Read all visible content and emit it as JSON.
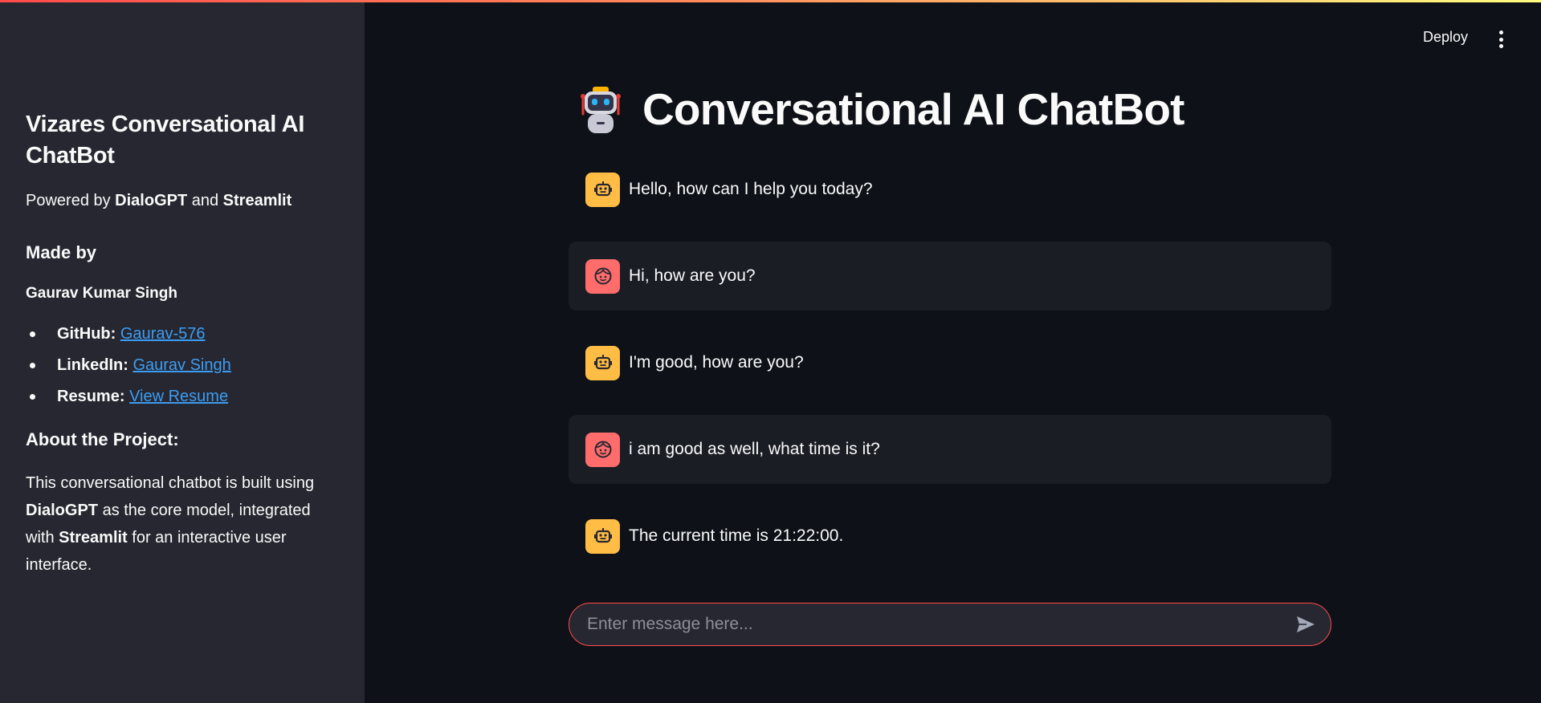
{
  "colors": {
    "bg": "#0e1117",
    "sidebar_bg": "#262730",
    "bot_avatar": "#ffbd45",
    "user_avatar": "#ff6c6c",
    "link": "#3d9df3",
    "accent": "#ff4b4b"
  },
  "sidebar": {
    "title": "Vizares Conversational AI ChatBot",
    "powered_prefix": "Powered by ",
    "powered_model": "DialoGPT",
    "powered_and": " and ",
    "powered_framework": "Streamlit",
    "made_by_heading": "Made by",
    "author": "Gaurav Kumar Singh",
    "links": [
      {
        "label": "GitHub:",
        "text": "Gaurav-576"
      },
      {
        "label": "LinkedIn:",
        "text": "Gaurav Singh"
      },
      {
        "label": "Resume:",
        "text": "View Resume"
      }
    ],
    "about_heading": "About the Project:",
    "about": {
      "p1": "This conversational chatbot is built using ",
      "b1": "DialoGPT",
      "p2": " as the core model, integrated with ",
      "b2": "Streamlit",
      "p3": " for an interactive user interface."
    }
  },
  "header": {
    "deploy_label": "Deploy",
    "menu_icon": "kebab-menu-icon"
  },
  "main": {
    "title": "Conversational AI ChatBot",
    "title_icon": "robot-emoji",
    "messages": [
      {
        "role": "assistant",
        "text": "Hello, how can I help you today?"
      },
      {
        "role": "user",
        "text": "Hi, how are you?"
      },
      {
        "role": "assistant",
        "text": "I'm good, how are you?"
      },
      {
        "role": "user",
        "text": "i am good as well, what time is it?"
      },
      {
        "role": "assistant",
        "text": "The current time is 21:22:00."
      }
    ],
    "input": {
      "placeholder": "Enter message here...",
      "value": ""
    }
  }
}
